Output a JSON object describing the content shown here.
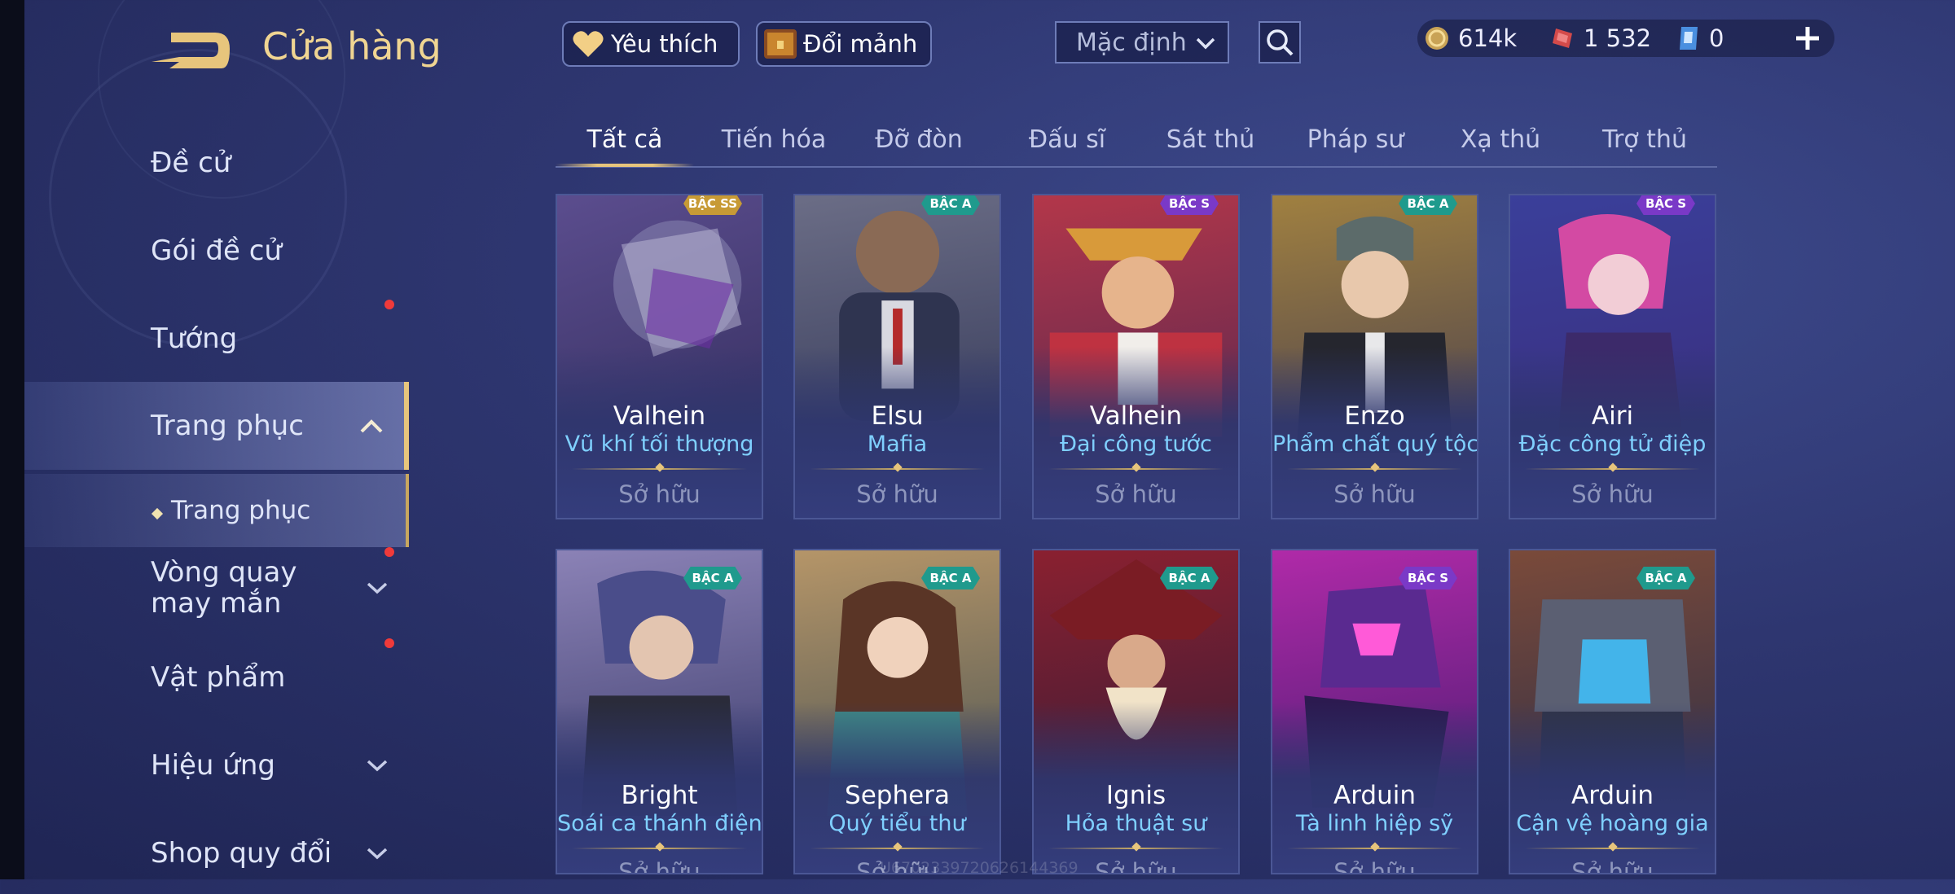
{
  "header": {
    "title": "Cửa hàng",
    "favorite_label": "Yêu thích",
    "exchange_label": "Đổi mảnh",
    "sort_selected": "Mặc định"
  },
  "currency": {
    "gold": "614k",
    "vouchers": "1 532",
    "tickets": "0"
  },
  "sidebar": {
    "items": [
      {
        "label": "Đề cử"
      },
      {
        "label": "Gói đề cử"
      },
      {
        "label": "Tướng"
      },
      {
        "label": "Trang phục"
      },
      {
        "label": "Trang phục"
      },
      {
        "label": "Vòng quay may mắn"
      },
      {
        "label": "Vật phẩm"
      },
      {
        "label": "Hiệu ứng"
      },
      {
        "label": "Shop quy đổi"
      }
    ]
  },
  "tabs": [
    "Tất cả",
    "Tiến hóa",
    "Đỡ đòn",
    "Đấu sĩ",
    "Sát thủ",
    "Pháp sư",
    "Xạ thủ",
    "Trợ thủ"
  ],
  "skins": [
    {
      "hero": "Valhein",
      "skin": "Vũ khí tối thượng",
      "tier": "BẬC SS",
      "status": "Sở hữu"
    },
    {
      "hero": "Elsu",
      "skin": "Mafia",
      "tier": "BẬC A",
      "status": "Sở hữu"
    },
    {
      "hero": "Valhein",
      "skin": "Đại công tước",
      "tier": "BẬC S",
      "status": "Sở hữu"
    },
    {
      "hero": "Enzo",
      "skin": "Phẩm chất quý tộc",
      "tier": "BẬC A",
      "status": "Sở hữu"
    },
    {
      "hero": "Airi",
      "skin": "Đặc công tử điệp",
      "tier": "BẬC S",
      "status": "Sở hữu"
    },
    {
      "hero": "Bright",
      "skin": "Soái ca thánh điện",
      "tier": "BẬC A",
      "status": "Sở hữu"
    },
    {
      "hero": "Sephera",
      "skin": "Quý tiểu thư",
      "tier": "BẬC A",
      "status": "Sở hữu"
    },
    {
      "hero": "Ignis",
      "skin": "Hỏa thuật sư",
      "tier": "BẬC A",
      "status": "Sở hữu"
    },
    {
      "hero": "Arduin",
      "skin": "Tà linh hiệp sỹ",
      "tier": "BẬC S",
      "status": "Sở hữu"
    },
    {
      "hero": "Arduin",
      "skin": "Cận vệ hoàng gia",
      "tier": "BẬC A",
      "status": "Sở hữu"
    }
  ],
  "watermark": "U6702339720626144369",
  "colors": {
    "accent_gold": "#e7c57c",
    "skin_name": "#7fd0ff",
    "notification": "#f03a3a"
  }
}
